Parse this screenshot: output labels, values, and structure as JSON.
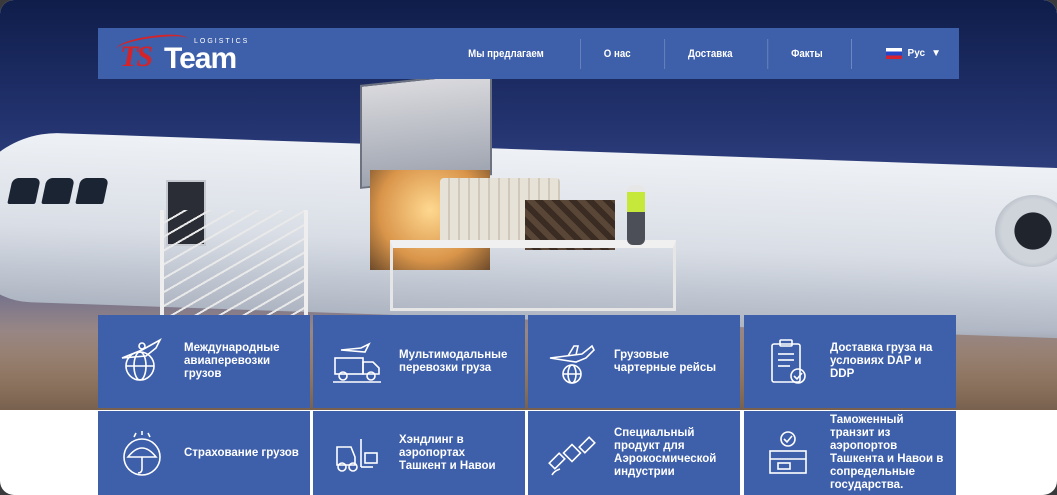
{
  "brand": {
    "name_prefix": "TS",
    "name_main": "Team",
    "tagline": "LOGISTICS"
  },
  "nav": {
    "items": [
      "Мы предлагаем",
      "О нас",
      "Доставка",
      "Факты"
    ],
    "language": "Рус"
  },
  "services": [
    {
      "label": "Международные авиаперевозки грузов",
      "icon": "globe-plane-icon"
    },
    {
      "label": "Мультимодальные перевозки груза",
      "icon": "truck-plane-icon"
    },
    {
      "label": "Грузовые чартерные рейсы",
      "icon": "plane-globe-icon"
    },
    {
      "label": "Доставка груза на условиях DAP и DDP",
      "icon": "clipboard-check-icon"
    },
    {
      "label": "Страхование грузов",
      "icon": "umbrella-icon"
    },
    {
      "label": "Хэндлинг в аэропортах Ташкент и Навои",
      "icon": "forklift-icon"
    },
    {
      "label": "Специальный продукт для Аэрокосмической индустрии",
      "icon": "satellite-icon"
    },
    {
      "label": "Таможенный транзит из аэропортов Ташкента и Навои в сопредельные государства.",
      "icon": "customs-box-icon"
    }
  ],
  "colors": {
    "nav_bg": "#3e5fa9",
    "brand_red": "#d4242a"
  }
}
